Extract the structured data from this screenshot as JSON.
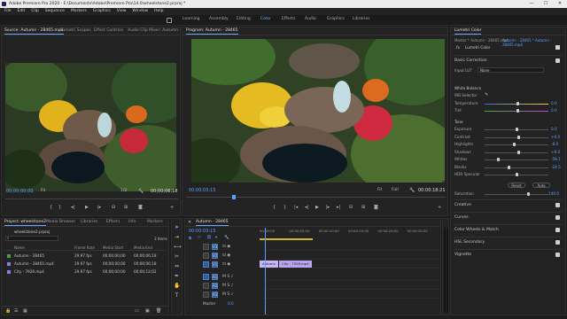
{
  "title_bar": {
    "title": "Adobe Premiere Pro 2020 - E:\\Documents\\Adobe\\Premiere Pro\\14.0\\wheelstone2.prproj *",
    "minimize": "—",
    "maximize": "☐",
    "close": "✕"
  },
  "menu": [
    "File",
    "Edit",
    "Clip",
    "Sequence",
    "Markers",
    "Graphics",
    "View",
    "Window",
    "Help"
  ],
  "workspaces": [
    "Learning",
    "Assembly",
    "Editing",
    "Color",
    "Effects",
    "Audio",
    "Graphics",
    "Libraries"
  ],
  "source_panel": {
    "tabs": [
      "Source: Autumn - 28465.mp4",
      "Lumetri Scopes",
      "Effect Controls",
      "Audio Clip Mixer: Autumn - 2..."
    ],
    "timecode": "00;00;00;00",
    "fit": "Fit",
    "resolution": "1/2",
    "duration": "00;00;06;18"
  },
  "program_panel": {
    "tab": "Program: Autumn - 28465",
    "timecode": "00:00:03:15",
    "fit": "Fit",
    "resolution": "Full",
    "duration": "00:00:18:21"
  },
  "lumetri": {
    "tab": "Lumetri Color",
    "master": "Master * Autumn - 28465.mp4",
    "sequence_clip": "Autumn - 28465 * Autumn - 28465.mp4",
    "fx_label": "fx",
    "fx_name": "Lumetri Color",
    "basic_correction": "Basic Correction",
    "input_lut_label": "Input LUT",
    "input_lut_value": "None",
    "white_balance": "White Balance",
    "wb_selector": "WB Selector",
    "temperature_label": "Temperature",
    "temperature_value": "0.0",
    "tint_label": "Tint",
    "tint_value": "0.0",
    "tone": "Tone",
    "tone_rows": [
      {
        "label": "Exposure",
        "value": "0.0",
        "pos": 0.5
      },
      {
        "label": "Contrast",
        "value": "+6.0",
        "pos": 0.53
      },
      {
        "label": "Highlights",
        "value": "-8.0",
        "pos": 0.46
      },
      {
        "label": "Shadows",
        "value": "+8.0",
        "pos": 0.54
      },
      {
        "label": "Whites",
        "value": "-58.1",
        "pos": 0.21
      },
      {
        "label": "Blacks",
        "value": "-24.5",
        "pos": 0.38
      },
      {
        "label": "HDR Specular",
        "value": "",
        "pos": 0.5
      }
    ],
    "reset_label": "Reset",
    "auto_label": "Auto",
    "saturation_label": "Saturation",
    "saturation_value": "140.0",
    "sections": [
      "Creative",
      "Curves",
      "Color Wheels & Match",
      "HSL Secondary",
      "Vignette"
    ]
  },
  "project_panel": {
    "tabs": [
      "Project: wheelstone2",
      "Media Browser",
      "Libraries",
      "Effects",
      "Info",
      "Markers"
    ],
    "filename": "wheelstone2.prproj",
    "items_count": "3 Items",
    "headers": [
      "Name",
      "Frame Rate",
      "Media Start",
      "Media End"
    ],
    "rows": [
      {
        "name": "Autumn - 28465",
        "rate": "29.97 fps",
        "start": "00;00;00;00",
        "end": "00;00;06;18",
        "color": "#3fa34d"
      },
      {
        "name": "Autumn - 28465.mp4",
        "rate": "29.97 fps",
        "start": "00;00;00;00",
        "end": "00;00;06;18",
        "color": "#8a7fd6"
      },
      {
        "name": "City - 7926.mp4",
        "rate": "29.97 fps",
        "start": "00;00;00;00",
        "end": "00;00;12;02",
        "color": "#8a7fd6"
      }
    ]
  },
  "timeline": {
    "tab": "Autumn - 28465",
    "timecode": "00:00:03:15",
    "ruler": [
      "00:00:00",
      "00:00:05:00",
      "00:00:10:00",
      "00:00:15:00",
      "00:00:20:00",
      "00:00:25:00"
    ],
    "playhead": 0.03,
    "video_tracks": [
      "V3",
      "V2",
      "V1"
    ],
    "audio_tracks": [
      "A1",
      "A2",
      "A3"
    ],
    "master_label": "Master",
    "master_value": "0.0",
    "clips": [
      {
        "label": "Autumn - 28465",
        "start": 0.0,
        "end": 0.11,
        "color": "#c7b6f5"
      },
      {
        "label": "City - 7926.mp4",
        "start": 0.11,
        "end": 0.3,
        "color": "#b8a4ef"
      }
    ]
  },
  "colors": {
    "accent_blue": "#5aa0ff",
    "clip_purple": "#b8a4ef",
    "work_area_yellow": "#d1b32a"
  }
}
